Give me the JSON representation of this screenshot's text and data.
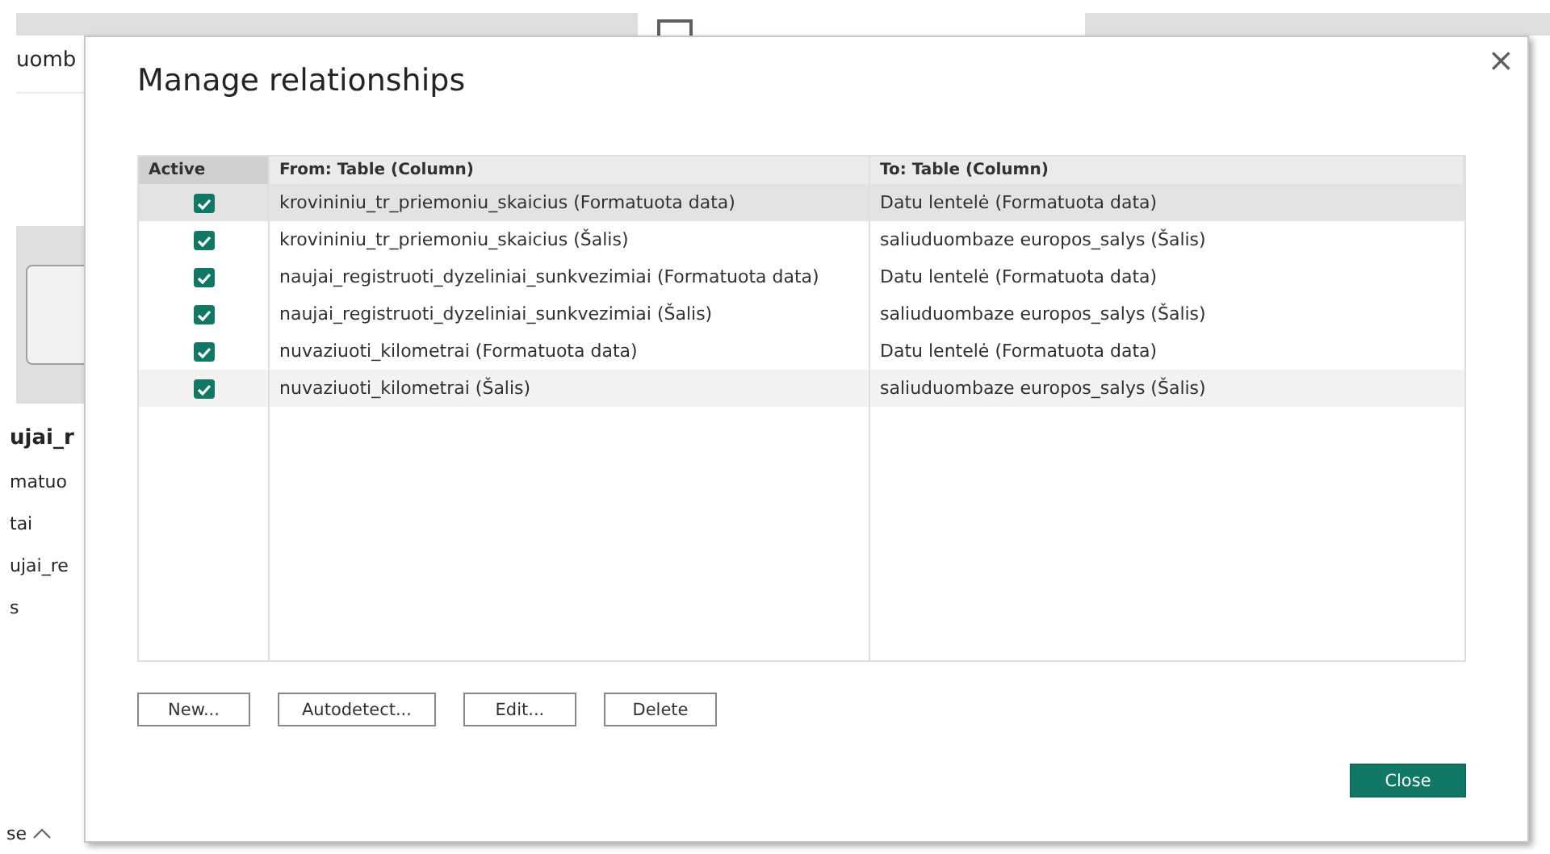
{
  "background": {
    "header_text": "uomb",
    "pane_title": "ujai_r",
    "list_items": [
      "matuo",
      "tai",
      "ujai_re",
      "s"
    ],
    "footer_text": "se"
  },
  "dialog": {
    "title": "Manage relationships",
    "close_symbol": "×",
    "table": {
      "columns": [
        "Active",
        "From: Table (Column)",
        "To: Table (Column)"
      ],
      "rows": [
        {
          "active": true,
          "selected": true,
          "hovered": false,
          "from": "krovininiu_tr_priemoniu_skaicius (Formatuota data)",
          "to": "Datu lentelė (Formatuota data)"
        },
        {
          "active": true,
          "selected": false,
          "hovered": false,
          "from": "krovininiu_tr_priemoniu_skaicius (Šalis)",
          "to": "saliuduombaze europos_salys (Šalis)"
        },
        {
          "active": true,
          "selected": false,
          "hovered": false,
          "from": "naujai_registruoti_dyzeliniai_sunkvezimiai (Formatuota data)",
          "to": "Datu lentelė (Formatuota data)"
        },
        {
          "active": true,
          "selected": false,
          "hovered": false,
          "from": "naujai_registruoti_dyzeliniai_sunkvezimiai (Šalis)",
          "to": "saliuduombaze europos_salys (Šalis)"
        },
        {
          "active": true,
          "selected": false,
          "hovered": false,
          "from": "nuvaziuoti_kilometrai (Formatuota data)",
          "to": "Datu lentelė (Formatuota data)"
        },
        {
          "active": true,
          "selected": false,
          "hovered": true,
          "from": "nuvaziuoti_kilometrai (Šalis)",
          "to": "saliuduombaze europos_salys (Šalis)"
        }
      ]
    },
    "buttons": [
      "New...",
      "Autodetect...",
      "Edit...",
      "Delete"
    ],
    "primary_button": "Close"
  }
}
